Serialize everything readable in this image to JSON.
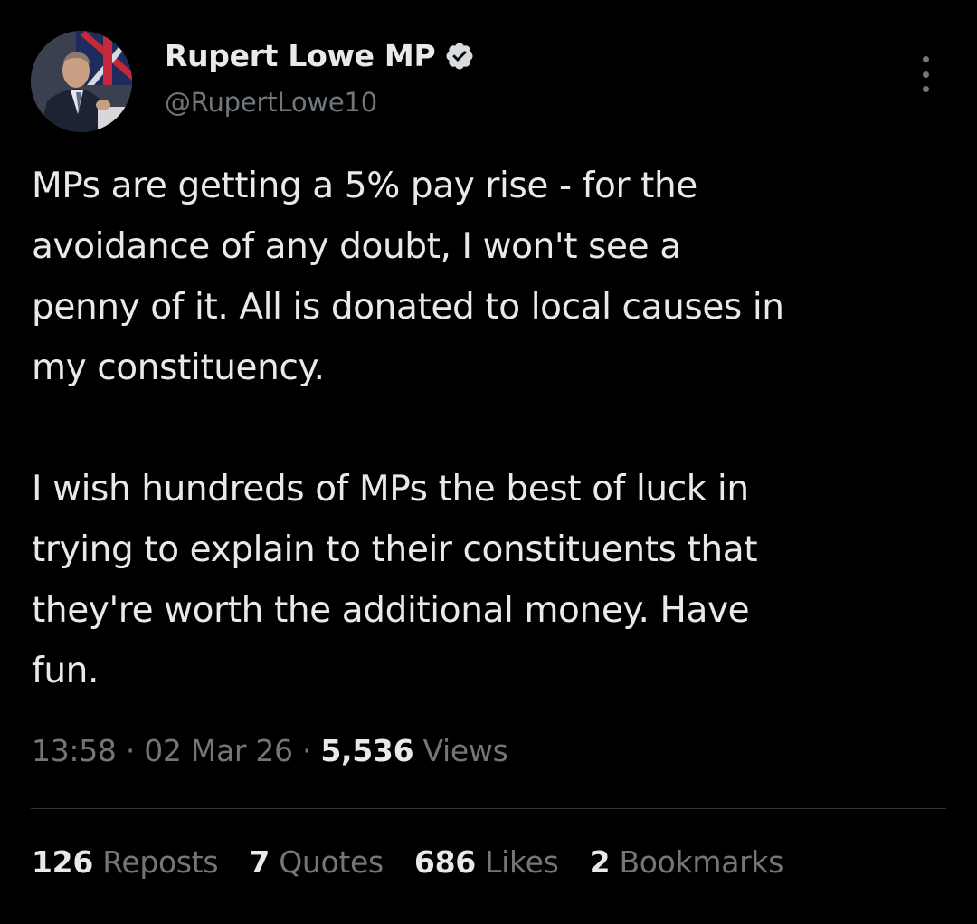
{
  "author": {
    "display_name": "Rupert Lowe MP",
    "handle": "@RupertLowe10",
    "verified_icon": "verified-badge-icon",
    "avatar_icon": "profile-photo"
  },
  "menu_icon": "more-options-icon",
  "tweet": {
    "paragraph_1": "MPs are getting a 5% pay rise - for the\navoidance of any doubt, I won't see a\npenny of it. All is donated to local causes in\nmy constituency.",
    "paragraph_2": "I wish hundreds of MPs the best of luck in\ntrying to explain to their constituents that\nthey're worth the additional money. Have\nfun."
  },
  "meta": {
    "time": "13:58",
    "separator": "·",
    "date": "02 Mar 26",
    "views_count": "5,536",
    "views_label": "Views"
  },
  "stats": {
    "reposts_count": "126",
    "reposts_label": "Reposts",
    "quotes_count": "7",
    "quotes_label": "Quotes",
    "likes_count": "686",
    "likes_label": "Likes",
    "bookmarks_count": "2",
    "bookmarks_label": "Bookmarks"
  },
  "colors": {
    "background": "#000000",
    "primary_text": "#e7e9ea",
    "secondary_text": "#71767b",
    "divider": "#2f3336",
    "verified": "#d8dcdf"
  }
}
